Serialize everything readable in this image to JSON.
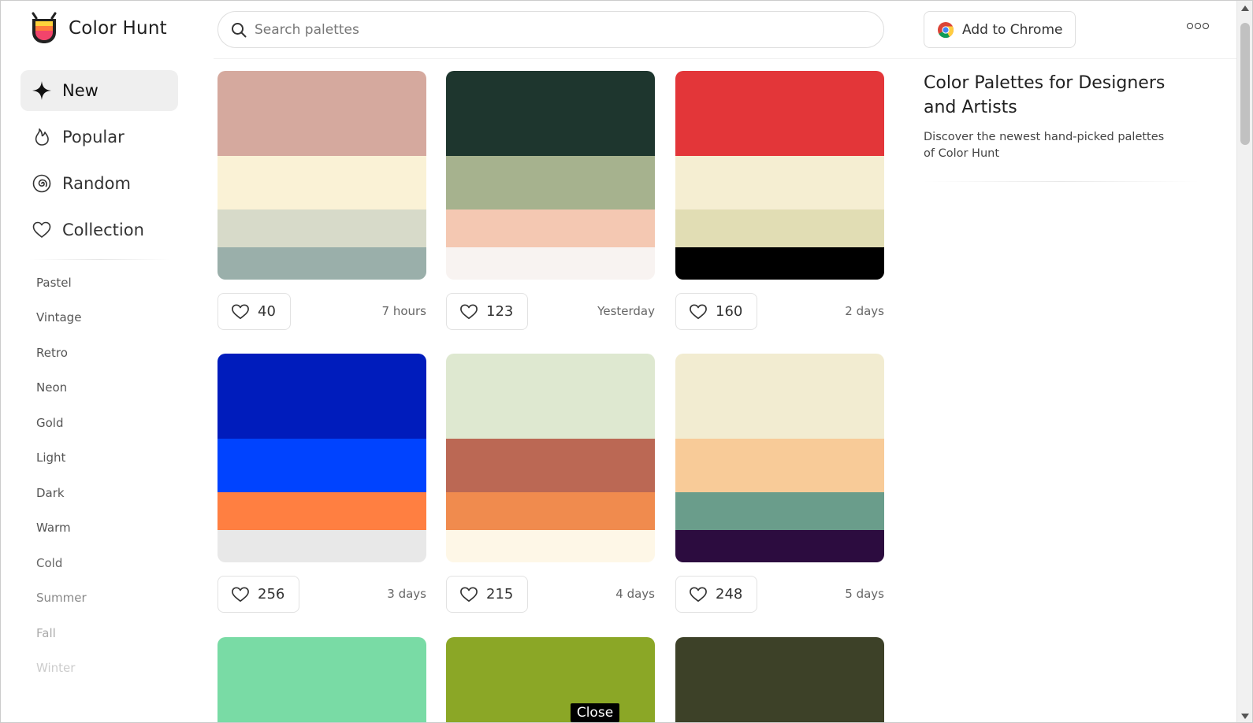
{
  "header": {
    "brand": "Color Hunt",
    "search_placeholder": "Search palettes",
    "chrome_button": "Add to Chrome"
  },
  "sidebar": {
    "nav": [
      {
        "label": "New",
        "icon": "sparkle-icon",
        "active": true
      },
      {
        "label": "Popular",
        "icon": "flame-icon",
        "active": false
      },
      {
        "label": "Random",
        "icon": "spiral-icon",
        "active": false
      },
      {
        "label": "Collection",
        "icon": "heart-icon",
        "active": false
      }
    ],
    "tags": [
      "Pastel",
      "Vintage",
      "Retro",
      "Neon",
      "Gold",
      "Light",
      "Dark",
      "Warm",
      "Cold",
      "Summer",
      "Fall",
      "Winter"
    ]
  },
  "palettes": [
    {
      "colors": [
        "#D5A99E",
        "#FAF2D6",
        "#D7DAC9",
        "#9AAFAA"
      ],
      "likes": "40",
      "date": "7 hours"
    },
    {
      "colors": [
        "#1E362E",
        "#A6B28E",
        "#F4C8B2",
        "#F8F3F1"
      ],
      "likes": "123",
      "date": "Yesterday"
    },
    {
      "colors": [
        "#E33639",
        "#F5EED2",
        "#E1DDB4",
        "#000000"
      ],
      "likes": "160",
      "date": "2 days"
    },
    {
      "colors": [
        "#001CBC",
        "#0043FF",
        "#FF7F41",
        "#E8E8E8"
      ],
      "likes": "256",
      "date": "3 days"
    },
    {
      "colors": [
        "#DEE8D0",
        "#BB6854",
        "#F08B4E",
        "#FEF7E7"
      ],
      "likes": "215",
      "date": "4 days"
    },
    {
      "colors": [
        "#F2ECD1",
        "#F8CB98",
        "#6A9D8B",
        "#2C0C3F"
      ],
      "likes": "248",
      "date": "5 days"
    },
    {
      "colors": [
        "#79DBA5"
      ],
      "likes": "",
      "date": ""
    },
    {
      "colors": [
        "#8BA726"
      ],
      "likes": "",
      "date": ""
    },
    {
      "colors": [
        "#3D4128"
      ],
      "likes": "",
      "date": ""
    }
  ],
  "about": {
    "title": "Color Palettes for Designers and Artists",
    "description": "Discover the newest hand-picked palettes of Color Hunt"
  },
  "tooltip": {
    "close": "Close"
  }
}
